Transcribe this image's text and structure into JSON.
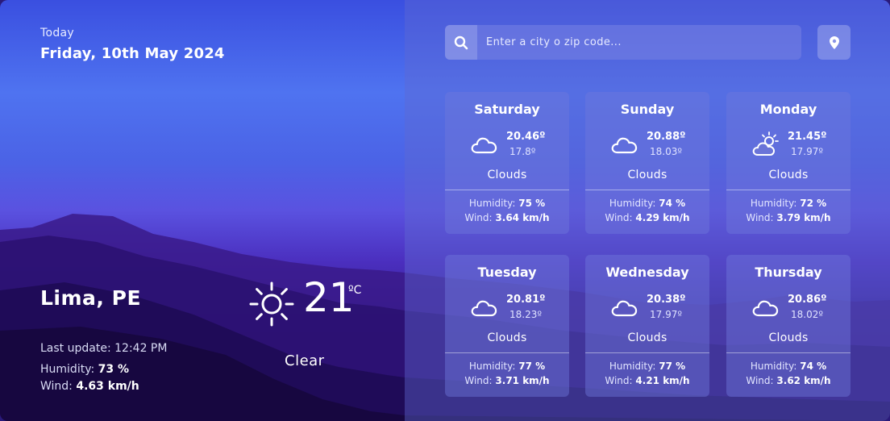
{
  "current": {
    "today_label": "Today",
    "date": "Friday, 10th May 2024",
    "city": "Lima, PE",
    "last_update_label": "Last update:",
    "last_update": "12:42 PM",
    "humidity_label": "Humidity:",
    "humidity": "73 %",
    "wind_label": "Wind:",
    "wind": "4.63 km/h",
    "temp": "21",
    "unit": "ºC",
    "description": "Clear",
    "icon": "sun-icon"
  },
  "search": {
    "placeholder": "Enter a city o zip code...",
    "value": ""
  },
  "labels": {
    "humidity": "Humidity:",
    "wind": "Wind:"
  },
  "forecast": [
    {
      "day": "Saturday",
      "max": "20.46º",
      "min": "17.8º",
      "description": "Clouds",
      "humidity": "75 %",
      "wind": "3.64 km/h",
      "icon": "cloud-icon"
    },
    {
      "day": "Sunday",
      "max": "20.88º",
      "min": "18.03º",
      "description": "Clouds",
      "humidity": "74 %",
      "wind": "4.29 km/h",
      "icon": "cloud-icon"
    },
    {
      "day": "Monday",
      "max": "21.45º",
      "min": "17.97º",
      "description": "Clouds",
      "humidity": "72 %",
      "wind": "3.79 km/h",
      "icon": "sun-cloud-icon"
    },
    {
      "day": "Tuesday",
      "max": "20.81º",
      "min": "18.23º",
      "description": "Clouds",
      "humidity": "77 %",
      "wind": "3.71 km/h",
      "icon": "cloud-icon"
    },
    {
      "day": "Wednesday",
      "max": "20.38º",
      "min": "17.97º",
      "description": "Clouds",
      "humidity": "77 %",
      "wind": "4.21 km/h",
      "icon": "cloud-icon"
    },
    {
      "day": "Thursday",
      "max": "20.86º",
      "min": "18.02º",
      "description": "Clouds",
      "humidity": "74 %",
      "wind": "3.62 km/h",
      "icon": "cloud-icon"
    }
  ]
}
